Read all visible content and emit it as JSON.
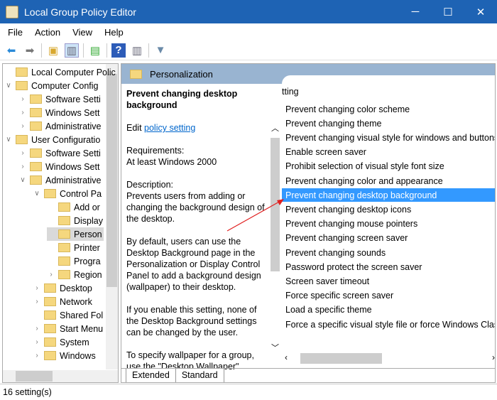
{
  "window": {
    "title": "Local Group Policy Editor",
    "minimize": "─",
    "maximize": "☐",
    "close": "✕"
  },
  "menu": [
    "File",
    "Action",
    "View",
    "Help"
  ],
  "tree": [
    {
      "label": "Local Computer Polic",
      "indent": 0,
      "chev": ""
    },
    {
      "label": "Computer Config",
      "indent": 0,
      "chev": "∨"
    },
    {
      "label": "Software Setti",
      "indent": 1,
      "chev": "›"
    },
    {
      "label": "Windows Sett",
      "indent": 1,
      "chev": "›"
    },
    {
      "label": "Administrative",
      "indent": 1,
      "chev": "›"
    },
    {
      "label": "User Configuratio",
      "indent": 0,
      "chev": "∨"
    },
    {
      "label": "Software Setti",
      "indent": 1,
      "chev": "›"
    },
    {
      "label": "Windows Sett",
      "indent": 1,
      "chev": "›"
    },
    {
      "label": "Administrative",
      "indent": 1,
      "chev": "∨"
    },
    {
      "label": "Control Pa",
      "indent": 2,
      "chev": "∨"
    },
    {
      "label": "Add or",
      "indent": 3,
      "chev": ""
    },
    {
      "label": "Display",
      "indent": 3,
      "chev": ""
    },
    {
      "label": "Person",
      "indent": 3,
      "chev": "",
      "selected": true
    },
    {
      "label": "Printer",
      "indent": 3,
      "chev": ""
    },
    {
      "label": "Progra",
      "indent": 3,
      "chev": ""
    },
    {
      "label": "Region",
      "indent": 3,
      "chev": "›"
    },
    {
      "label": "Desktop",
      "indent": 2,
      "chev": "›"
    },
    {
      "label": "Network",
      "indent": 2,
      "chev": "›"
    },
    {
      "label": "Shared Fol",
      "indent": 2,
      "chev": ""
    },
    {
      "label": "Start Menu",
      "indent": 2,
      "chev": "›"
    },
    {
      "label": "System",
      "indent": 2,
      "chev": "›"
    },
    {
      "label": "Windows",
      "indent": 2,
      "chev": "›"
    }
  ],
  "panel": {
    "header": "Personalization",
    "title": "Prevent changing desktop background",
    "edit_prefix": "Edit ",
    "edit_link": "policy setting",
    "requirements": "Requirements:",
    "req_value": "At least Windows 2000",
    "description_label": "Description:",
    "description": "Prevents users from adding or changing the background design of the desktop.",
    "para2": "By default, users can use the Desktop Background page in the Personalization or Display Control Panel to add a background design (wallpaper) to their desktop.",
    "para3": "If you enable this setting, none of the Desktop Background settings can be changed by the user.",
    "para4": "To specify wallpaper for a group, use the \"Desktop Wallpaper\""
  },
  "list": {
    "header": "tting",
    "items": [
      "Prevent changing color scheme",
      "Prevent changing theme",
      "Prevent changing visual style for windows and buttons",
      "Enable screen saver",
      "Prohibit selection of visual style font size",
      "Prevent changing color and appearance",
      "Prevent changing desktop background",
      "Prevent changing desktop icons",
      "Prevent changing mouse pointers",
      "Prevent changing screen saver",
      "Prevent changing sounds",
      "Password protect the screen saver",
      "Screen saver timeout",
      "Force specific screen saver",
      "Load a specific theme",
      "Force a specific visual style file or force Windows Classic"
    ],
    "selected_index": 6
  },
  "tabs": [
    "Extended",
    "Standard"
  ],
  "status": "16 setting(s)"
}
